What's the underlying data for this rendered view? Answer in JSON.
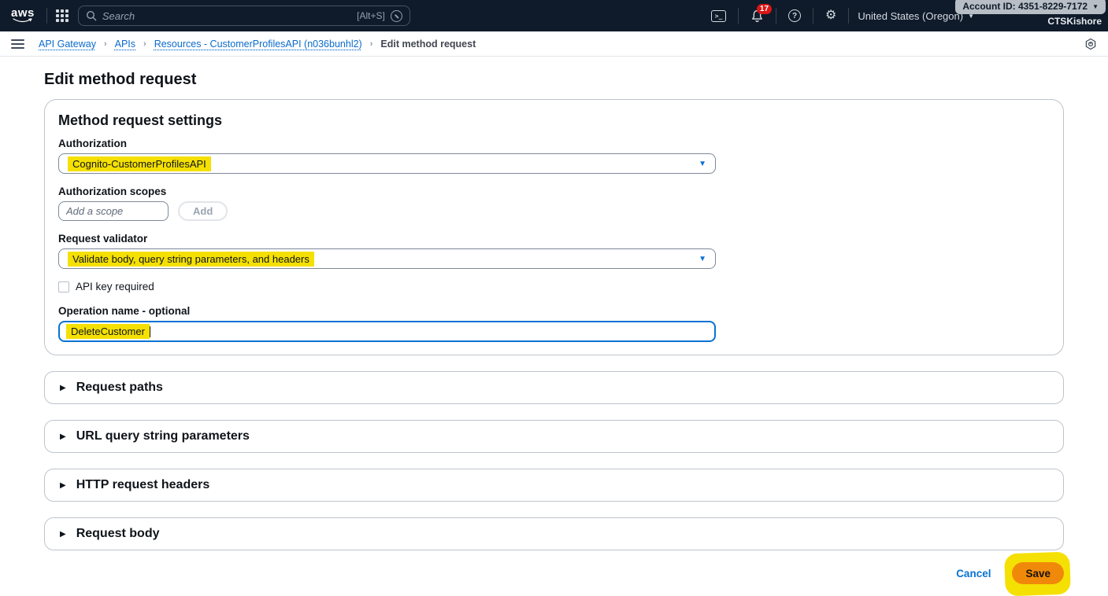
{
  "topbar": {
    "logo": "aws",
    "search": {
      "placeholder": "Search",
      "shortcut": "[Alt+S]"
    },
    "notification_count": "17",
    "region": "United States (Oregon)",
    "account_id": "Account ID: 4351-8229-7172",
    "account_name": "CTSKishore"
  },
  "icons": {
    "terminal_glyph": ">_",
    "help_glyph": "?",
    "gear_glyph": "⚙",
    "caret_down": "▼",
    "breadcrumb_separator": "›",
    "accordion_arrow": "▶"
  },
  "breadcrumb": {
    "items": [
      {
        "label": "API Gateway"
      },
      {
        "label": "APIs"
      },
      {
        "label": "Resources - CustomerProfilesAPI (n036bunhl2)"
      },
      {
        "label": "Edit method request"
      }
    ]
  },
  "page": {
    "title": "Edit method request"
  },
  "settings_card": {
    "title": "Method request settings",
    "authorization": {
      "label": "Authorization",
      "value": "Cognito-CustomerProfilesAPI"
    },
    "authorization_scopes": {
      "label": "Authorization scopes",
      "placeholder": "Add a scope",
      "add_button": "Add"
    },
    "request_validator": {
      "label": "Request validator",
      "value": "Validate body, query string parameters, and headers"
    },
    "api_key": {
      "label": "API key required",
      "checked": false
    },
    "operation_name": {
      "label": "Operation name - optional",
      "value": "DeleteCustomer"
    }
  },
  "sections": [
    {
      "label": "Request paths"
    },
    {
      "label": "URL query string parameters"
    },
    {
      "label": "HTTP request headers"
    },
    {
      "label": "Request body"
    }
  ],
  "footer": {
    "cancel_label": "Cancel",
    "save_label": "Save"
  },
  "colors": {
    "header_bg": "#0f1b2a",
    "link_blue": "#0972d3",
    "highlight_yellow": "#f5e003",
    "save_orange": "#f0890a",
    "badge_red": "#d91515"
  }
}
